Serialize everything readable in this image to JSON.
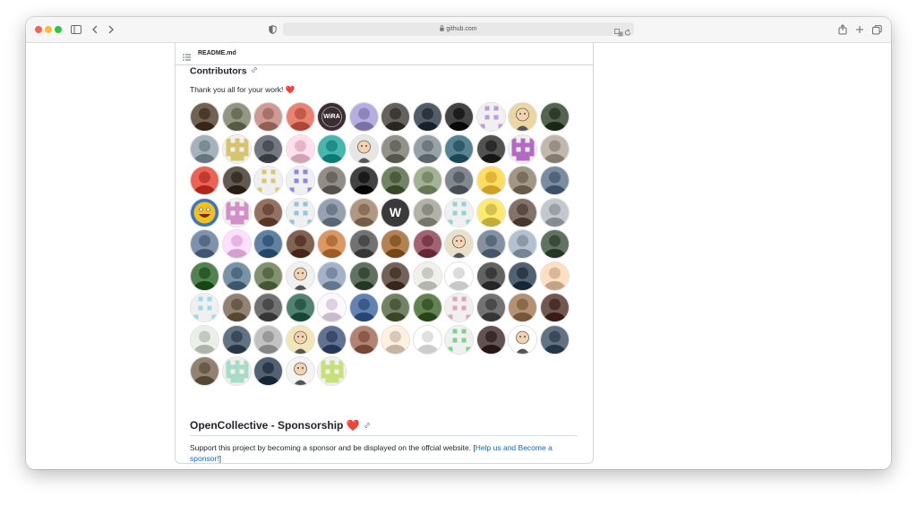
{
  "browser": {
    "address": "github.com",
    "lock_icon": "lock-icon"
  },
  "readme": {
    "file_name": "README.md"
  },
  "contributors": {
    "heading": "Contributors",
    "thanks_text": "Thank you all for your work!",
    "heart": "❤️",
    "avatars": [
      {
        "kind": "photo",
        "c": "#4a3a2c"
      },
      {
        "kind": "photo",
        "c": "#6b6f5a"
      },
      {
        "kind": "photo",
        "c": "#a7726a"
      },
      {
        "kind": "photo",
        "c": "#c25a4a"
      },
      {
        "kind": "text",
        "c": "#3a2d33",
        "t": "WiRA"
      },
      {
        "kind": "photo",
        "c": "#8e86b8"
      },
      {
        "kind": "photo",
        "c": "#3d3a35"
      },
      {
        "kind": "photo",
        "c": "#2c3440"
      },
      {
        "kind": "photo",
        "c": "#1c1c1c"
      },
      {
        "kind": "pixel",
        "c": "#b99cd9"
      },
      {
        "kind": "cartoon",
        "c": "#e9d6a0"
      },
      {
        "kind": "photo",
        "c": "#2e3a2a"
      },
      {
        "kind": "photo",
        "c": "#7b8a93"
      },
      {
        "kind": "pixel",
        "c": "#d6c56a"
      },
      {
        "kind": "photo",
        "c": "#4b5058"
      },
      {
        "kind": "photo",
        "c": "#e7b6c5"
      },
      {
        "kind": "photo",
        "c": "#1f8e86"
      },
      {
        "kind": "cartoon",
        "c": "#e6e6e6"
      },
      {
        "kind": "photo",
        "c": "#6a6a62"
      },
      {
        "kind": "photo",
        "c": "#707880"
      },
      {
        "kind": "photo",
        "c": "#2f5a6a"
      },
      {
        "kind": "photo",
        "c": "#2a2a2a"
      },
      {
        "kind": "pixel",
        "c": "#b469c4"
      },
      {
        "kind": "photo",
        "c": "#9a8f85"
      },
      {
        "kind": "photo",
        "c": "#c33b2e"
      },
      {
        "kind": "photo",
        "c": "#3a3228"
      },
      {
        "kind": "pixel",
        "c": "#d9c66f"
      },
      {
        "kind": "pixel",
        "c": "#8e86e0"
      },
      {
        "kind": "photo",
        "c": "#6a655e"
      },
      {
        "kind": "photo",
        "c": "#1a1a1a"
      },
      {
        "kind": "photo",
        "c": "#4c5a3e"
      },
      {
        "kind": "photo",
        "c": "#7a8a6a"
      },
      {
        "kind": "photo",
        "c": "#5a6068"
      },
      {
        "kind": "photo",
        "c": "#e2b43a"
      },
      {
        "kind": "photo",
        "c": "#7a6e5c"
      },
      {
        "kind": "photo",
        "c": "#52647a"
      },
      {
        "kind": "smiley",
        "c": "#f2c21a"
      },
      {
        "kind": "pixel",
        "c": "#d48fc8"
      },
      {
        "kind": "photo",
        "c": "#6b4a3a"
      },
      {
        "kind": "pixel",
        "c": "#8fc6d6"
      },
      {
        "kind": "photo",
        "c": "#6d7a8a"
      },
      {
        "kind": "photo",
        "c": "#8a6f5a"
      },
      {
        "kind": "letter",
        "c": "#3a3a3a",
        "t": "W"
      },
      {
        "kind": "photo",
        "c": "#8a8a80"
      },
      {
        "kind": "pixel",
        "c": "#8fd6d0"
      },
      {
        "kind": "photo",
        "c": "#d6c24a"
      },
      {
        "kind": "photo",
        "c": "#5a4a42"
      },
      {
        "kind": "photo",
        "c": "#9aa0a6"
      },
      {
        "kind": "photo",
        "c": "#566a86"
      },
      {
        "kind": "photo",
        "c": "#e6b6e0"
      },
      {
        "kind": "photo",
        "c": "#385a7a"
      },
      {
        "kind": "photo",
        "c": "#5a3a2a"
      },
      {
        "kind": "photo",
        "c": "#b3703a"
      },
      {
        "kind": "photo",
        "c": "#4a4a4a"
      },
      {
        "kind": "photo",
        "c": "#8a5a2a"
      },
      {
        "kind": "photo",
        "c": "#7a3a4a"
      },
      {
        "kind": "cartoon",
        "c": "#e8e0c8"
      },
      {
        "kind": "photo",
        "c": "#5a6a7a"
      },
      {
        "kind": "photo",
        "c": "#8a98a8"
      },
      {
        "kind": "photo",
        "c": "#3a4a3a"
      },
      {
        "kind": "photo",
        "c": "#2a5a2a"
      },
      {
        "kind": "photo",
        "c": "#506a80"
      },
      {
        "kind": "photo",
        "c": "#5a6a48"
      },
      {
        "kind": "cartoon",
        "c": "#f0f0f0"
      },
      {
        "kind": "photo",
        "c": "#7a8aa0"
      },
      {
        "kind": "photo",
        "c": "#3a4a38"
      },
      {
        "kind": "photo",
        "c": "#4a3a30"
      },
      {
        "kind": "photo",
        "c": "#c9c9c4"
      },
      {
        "kind": "photo",
        "c": "#dcdcdc"
      },
      {
        "kind": "photo",
        "c": "#3a3a3a"
      },
      {
        "kind": "photo",
        "c": "#2a3a4a"
      },
      {
        "kind": "photo",
        "c": "#d9b79a"
      },
      {
        "kind": "pixel",
        "c": "#9adbe6"
      },
      {
        "kind": "photo",
        "c": "#6a5a4a"
      },
      {
        "kind": "photo",
        "c": "#4a4a4a"
      },
      {
        "kind": "photo",
        "c": "#2a5a4a"
      },
      {
        "kind": "photo",
        "c": "#dcd0e0"
      },
      {
        "kind": "photo",
        "c": "#3a5a8a"
      },
      {
        "kind": "photo",
        "c": "#4a5a3a"
      },
      {
        "kind": "photo",
        "c": "#3a5a2a"
      },
      {
        "kind": "pixel",
        "c": "#e2a3b4"
      },
      {
        "kind": "photo",
        "c": "#4a4a4a"
      },
      {
        "kind": "photo",
        "c": "#8a6a4a"
      },
      {
        "kind": "photo",
        "c": "#4a3028"
      },
      {
        "kind": "photo",
        "c": "#c2c8c0"
      },
      {
        "kind": "photo",
        "c": "#3a4a5a"
      },
      {
        "kind": "photo",
        "c": "#9a9a9a"
      },
      {
        "kind": "cartoon",
        "c": "#f2e6b8"
      },
      {
        "kind": "photo",
        "c": "#3a4a6a"
      },
      {
        "kind": "photo",
        "c": "#8a5a4a"
      },
      {
        "kind": "photo",
        "c": "#d8c8b8"
      },
      {
        "kind": "photo",
        "c": "#e0e0e0"
      },
      {
        "kind": "pixel",
        "c": "#7ad48a"
      },
      {
        "kind": "photo",
        "c": "#3a2a2a"
      },
      {
        "kind": "cartoon",
        "c": "#ffffff"
      },
      {
        "kind": "photo",
        "c": "#3a4a5a"
      },
      {
        "kind": "photo",
        "c": "#6a5a4a"
      },
      {
        "kind": "pixel",
        "c": "#a8dcc8"
      },
      {
        "kind": "photo",
        "c": "#2a3a4a"
      },
      {
        "kind": "cartoon",
        "c": "#f4f4f4"
      },
      {
        "kind": "pixel",
        "c": "#c8e07a"
      }
    ]
  },
  "sponsorship": {
    "heading": "OpenCollective - Sponsorship",
    "heart": "❤️",
    "text_before": "Support this project by becoming a sponsor and be displayed on the offcial website. [",
    "link_text": "Help us and Become a sponsor!",
    "text_after": "]"
  },
  "colors": {
    "link": "#0969da",
    "text": "#1f2328",
    "border": "#d0d7de"
  }
}
